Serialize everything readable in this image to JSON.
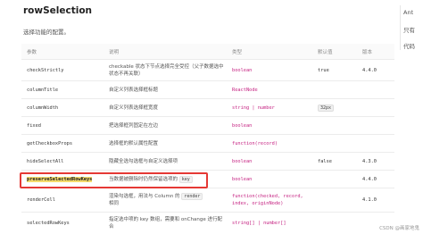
{
  "title": "rowSelection",
  "description": "选择功能的配置。",
  "headers": [
    "参数",
    "说明",
    "类型",
    "默认值",
    "版本"
  ],
  "rows": [
    {
      "param": "checkStrictly",
      "desc": "checkable 状态下节点选择完全受控（父子数据选中状态不再关联）",
      "type": "boolean",
      "default": "true",
      "version": "4.4.0"
    },
    {
      "param": "columnTitle",
      "desc": "自定义列表选择框标题",
      "type": "ReactNode",
      "default": "",
      "version": ""
    },
    {
      "param": "columnWidth",
      "desc": "自定义列表选择框宽度",
      "type": "string | number",
      "default": "32px",
      "version": ""
    },
    {
      "param": "fixed",
      "desc": "把选择框列固定在左边",
      "type": "boolean",
      "default": "",
      "version": ""
    },
    {
      "param": "getCheckboxProps",
      "desc": "选择框的默认属性配置",
      "type": "function(record)",
      "default": "",
      "version": ""
    },
    {
      "param": "hideSelectAll",
      "desc": "隐藏全选勾选框与自定义选择项",
      "type": "boolean",
      "default": "false",
      "version": "4.3.0"
    },
    {
      "param": "preserveSelectedRowKeys",
      "desc_prefix": "当数据被删除时仍然保留选项的",
      "desc_code": "key",
      "type": "boolean",
      "default": "",
      "version": "4.4.0"
    },
    {
      "param": "renderCell",
      "desc_prefix": "渲染勾选框，用法与 Column 的",
      "desc_code": "render",
      "desc_suffix": "相同",
      "type": "function(checked, record, index, originNode)",
      "default": "",
      "version": "4.1.0"
    },
    {
      "param": "selectedRowKeys",
      "desc_prefix": "指定选中项的 key 数组，需要和 onChange 进行配合",
      "type": "string[] | number[]",
      "default": "",
      "version": ""
    }
  ],
  "side": [
    "Ant",
    "只有",
    "代码"
  ],
  "watermark": "CSDN @画家地鬼",
  "colors": {
    "type": "#c41d7f",
    "highlight": "#f6dc6c",
    "box": "#e53935"
  }
}
